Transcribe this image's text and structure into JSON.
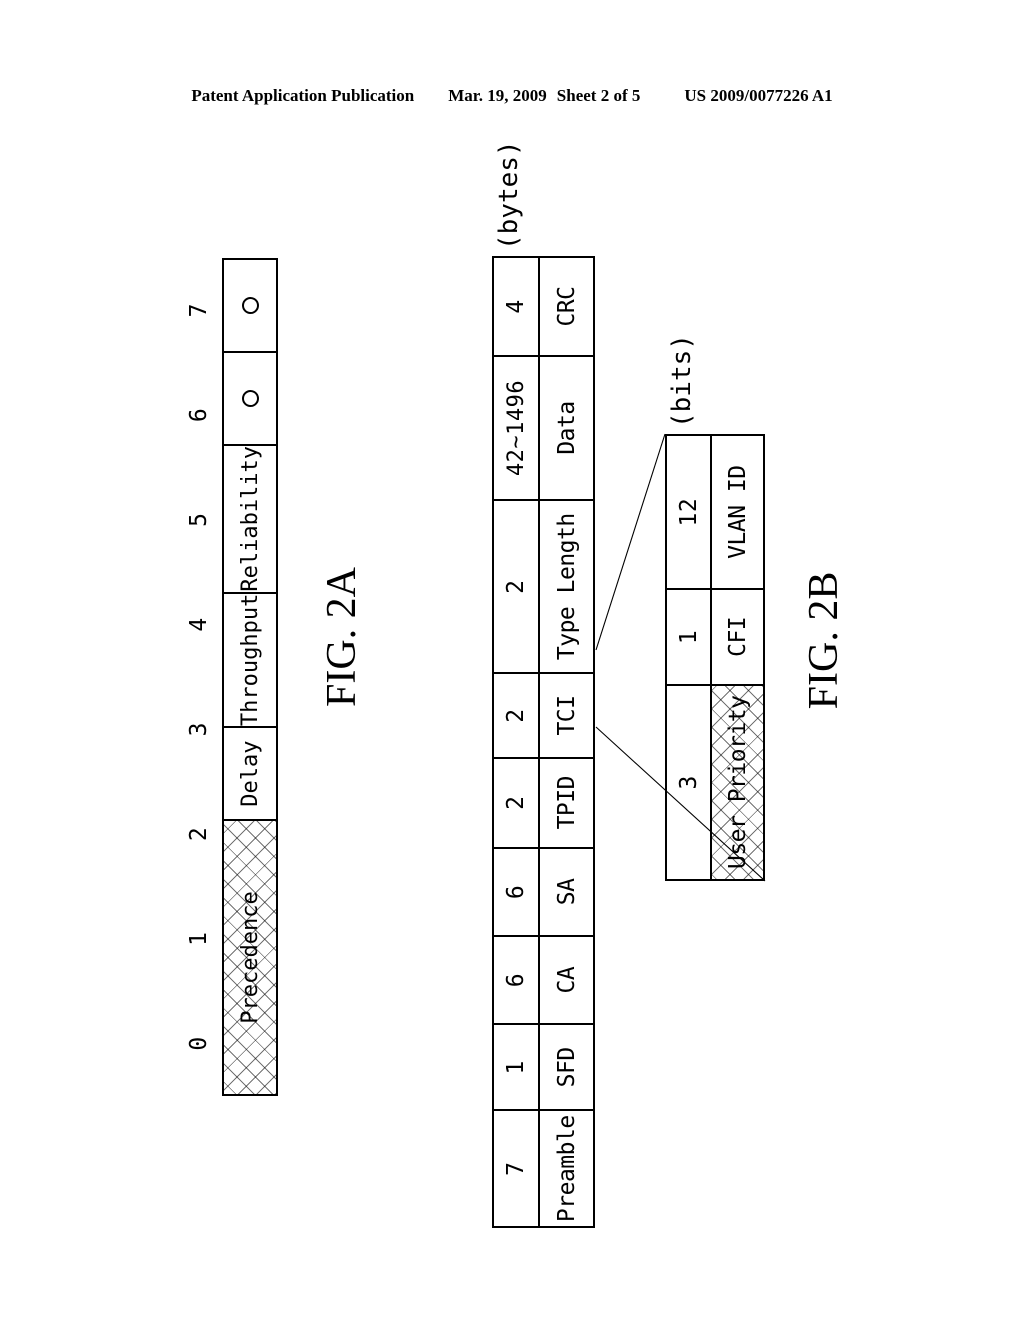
{
  "header": {
    "publication": "Patent Application Publication",
    "date": "Mar. 19, 2009",
    "sheet": "Sheet 2 of 5",
    "patent_number": "US 2009/0077226 A1"
  },
  "figures": [
    {
      "id": "fig2a",
      "caption": "FIG. 2A",
      "axis_label": "",
      "bit_numbers": [
        "0",
        "1",
        "2",
        "3",
        "4",
        "5",
        "6",
        "7"
      ],
      "fields": [
        {
          "name": "Precedence",
          "span": 3,
          "shaded": true,
          "glyph": "text"
        },
        {
          "name": "Delay",
          "span": 1,
          "shaded": false,
          "glyph": "text"
        },
        {
          "name": "Throughput",
          "span": 1,
          "shaded": false,
          "glyph": "text"
        },
        {
          "name": "Reliability",
          "span": 1,
          "shaded": false,
          "glyph": "text"
        },
        {
          "name": "O",
          "span": 1,
          "shaded": false,
          "glyph": "circle"
        },
        {
          "name": "O",
          "span": 1,
          "shaded": false,
          "glyph": "circle"
        }
      ]
    },
    {
      "id": "fig2b",
      "caption": "FIG. 2B",
      "unit_label": "(bytes)",
      "fields": [
        {
          "size": "7",
          "name": "Preamble",
          "shaded": false
        },
        {
          "size": "1",
          "name": "SFD",
          "shaded": false
        },
        {
          "size": "6",
          "name": "CA",
          "shaded": false
        },
        {
          "size": "6",
          "name": "SA",
          "shaded": false
        },
        {
          "size": "2",
          "name": "TPID",
          "shaded": false
        },
        {
          "size": "2",
          "name": "TCI",
          "shaded": false
        },
        {
          "size": "2",
          "name": "Type Length",
          "shaded": false
        },
        {
          "size": "42~1496",
          "name": "Data",
          "shaded": false
        },
        {
          "size": "4",
          "name": "CRC",
          "shaded": false
        }
      ],
      "expansion": {
        "unit_label": "(bits)",
        "source_field": "TCI",
        "fields": [
          {
            "size": "3",
            "name": "User Priority",
            "shaded": true
          },
          {
            "size": "1",
            "name": "CFI",
            "shaded": false
          },
          {
            "size": "12",
            "name": "VLAN ID",
            "shaded": false
          }
        ]
      }
    }
  ],
  "colors": {
    "ink": "#000000",
    "paper": "#ffffff"
  }
}
